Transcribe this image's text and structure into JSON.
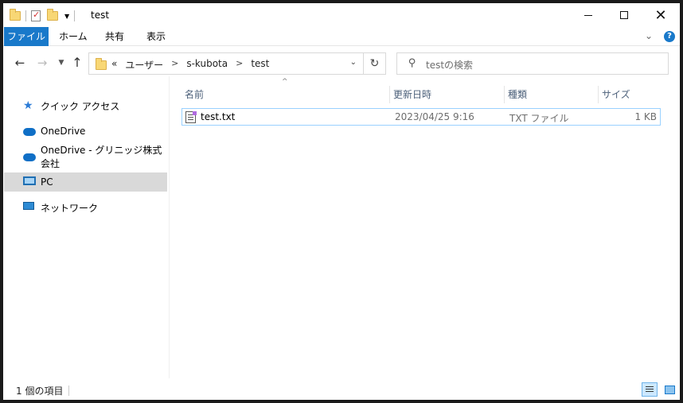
{
  "window": {
    "title": "test"
  },
  "ribbon": {
    "tabs": [
      {
        "label": "ファイル",
        "active": true
      },
      {
        "label": "ホーム"
      },
      {
        "label": "共有"
      },
      {
        "label": "表示"
      }
    ],
    "help": "?"
  },
  "navigation": {
    "breadcrumbs": [
      "«",
      "ユーザー",
      "s-kubota",
      "test"
    ],
    "search_placeholder": "testの検索"
  },
  "sidebar": {
    "items": [
      {
        "label": "クイック アクセス",
        "icon": "star-icon"
      },
      {
        "label": "OneDrive",
        "icon": "cloud-icon"
      },
      {
        "label": "OneDrive - グリニッジ株式会社",
        "icon": "cloud-icon"
      },
      {
        "label": "PC",
        "icon": "pc-icon",
        "selected": true
      },
      {
        "label": "ネットワーク",
        "icon": "network-icon"
      }
    ]
  },
  "file_list": {
    "columns": [
      "名前",
      "更新日時",
      "種類",
      "サイズ"
    ],
    "rows": [
      {
        "name": "test.txt",
        "modified": "2023/04/25 9:16",
        "type": "TXT ファイル",
        "size": "1 KB"
      }
    ]
  },
  "status": {
    "item_count": "1 個の項目"
  },
  "colors": {
    "accent": "#1979ca",
    "selection_border": "#99d1ff",
    "sidebar_selected": "#d9d9d9"
  }
}
